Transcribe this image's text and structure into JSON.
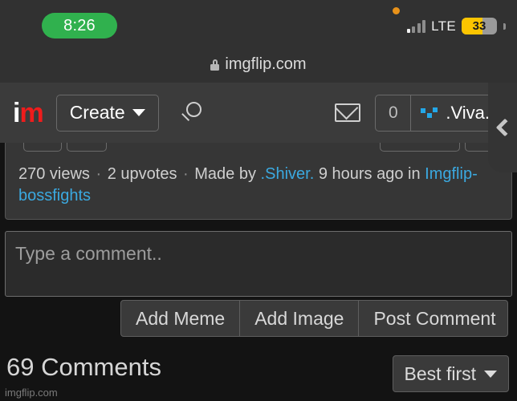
{
  "status_bar": {
    "time": "8:26",
    "network": "LTE",
    "battery_percent": "33",
    "battery_color": "#fcc500",
    "time_pill_color": "#30b14e",
    "recording_dot_color": "#e8921a"
  },
  "browser": {
    "url": "imgflip.com",
    "lock_icon": "lock-icon"
  },
  "navbar": {
    "logo_first": "i",
    "logo_second": "m",
    "logo_accent_color": "#ef1c1c",
    "create_label": "Create",
    "search_icon": "search-icon",
    "mail_icon": "envelope-icon",
    "message_count": "0",
    "username": ".Viva.",
    "avatar_color": "#23a7e8"
  },
  "edge_panel": {
    "back_icon": "chevron-left-icon"
  },
  "post_meta": {
    "views": "270 views",
    "separator": "·",
    "upvotes": "2 upvotes",
    "made_by_prefix": "Made by",
    "author": ".Shiver.",
    "time_ago": "9 hours ago",
    "in_prefix": "in",
    "stream": "Imgflip-bossfights",
    "link_color": "#3ba9e0"
  },
  "comment_form": {
    "placeholder": "Type a comment..",
    "value": "",
    "buttons": [
      {
        "label": "Add Meme",
        "name": "add-meme-button"
      },
      {
        "label": "Add Image",
        "name": "add-image-button"
      },
      {
        "label": "Post Comment",
        "name": "post-comment-button"
      }
    ]
  },
  "comments_section": {
    "title": "69 Comments",
    "sort_label": "Best first",
    "watermark": "imgflip.com"
  }
}
